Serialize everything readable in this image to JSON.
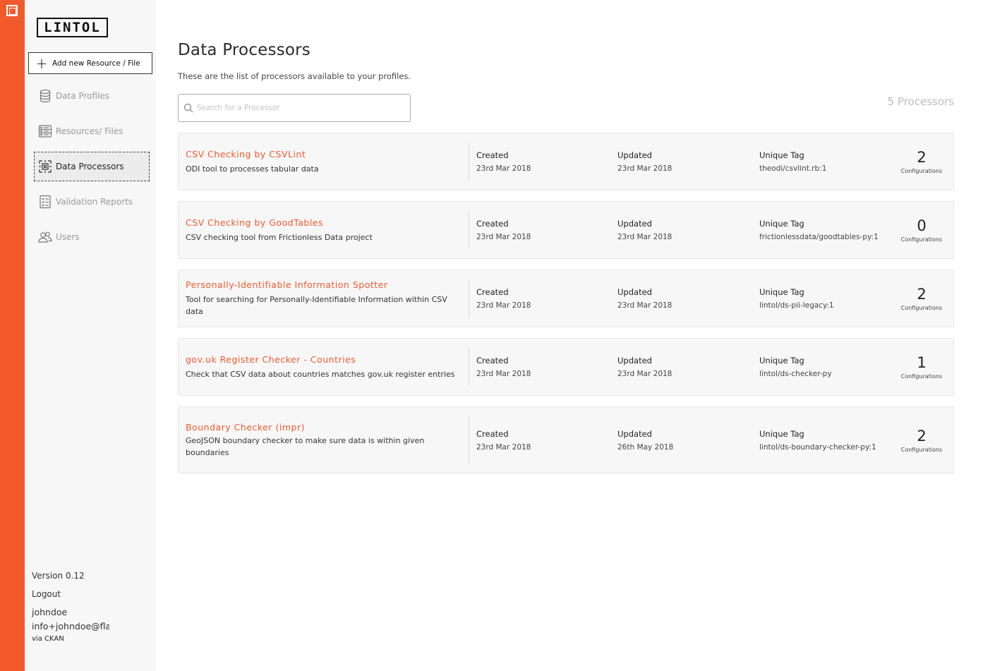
{
  "sidebar": {
    "logo": "LINTOL",
    "add_button": "Add new Resource / File",
    "items": [
      {
        "label": "Data Profiles",
        "icon": "database-icon"
      },
      {
        "label": "Resources/ Files",
        "icon": "files-icon"
      },
      {
        "label": "Data Processors",
        "icon": "processor-icon"
      },
      {
        "label": "Validation Reports",
        "icon": "checklist-icon"
      },
      {
        "label": "Users",
        "icon": "users-icon"
      }
    ],
    "active_item": "Data Processors",
    "version": "Version 0.12",
    "logout": "Logout",
    "username": "johndoe",
    "email": "info+johndoe@fla",
    "via": "via CKAN"
  },
  "page": {
    "title": "Data Processors",
    "subtitle": "These are the list of processors available to your profiles.",
    "search_placeholder": "Search for a Processor",
    "count_label": "5 Processors"
  },
  "labels": {
    "created": "Created",
    "updated": "Updated",
    "unique_tag": "Unique Tag",
    "configurations": "Configurations"
  },
  "processors": [
    {
      "name": "CSV Checking by CSVLint",
      "description": "ODI tool to processes tabular data",
      "created": "23rd Mar 2018",
      "updated": "23rd Mar 2018",
      "tag": "theodi/csvlint.rb:1",
      "configurations": "2"
    },
    {
      "name": "CSV Checking by GoodTables",
      "description": "CSV checking tool from Frictionless Data project",
      "created": "23rd Mar 2018",
      "updated": "23rd Mar 2018",
      "tag": "frictionlessdata/goodtables-py:1",
      "configurations": "0"
    },
    {
      "name": "Personally-Identifiable Information Spotter",
      "description": "Tool for searching for Personally-Identifiable Information within CSV data",
      "created": "23rd Mar 2018",
      "updated": "23rd Mar 2018",
      "tag": "lintol/ds-pii-legacy:1",
      "configurations": "2"
    },
    {
      "name": "gov.uk Register Checker - Countries",
      "description": "Check that CSV data about countries matches gov.uk register entries",
      "created": "23rd Mar 2018",
      "updated": "23rd Mar 2018",
      "tag": "lintol/ds-checker-py",
      "configurations": "1"
    },
    {
      "name": "Boundary Checker (impr)",
      "description": "GeoJSON boundary checker to make sure data is within given boundaries",
      "created": "23rd Mar 2018",
      "updated": "26th May 2018",
      "tag": "lintol/ds-boundary-checker-py:1",
      "configurations": "2"
    }
  ],
  "colors": {
    "accent": "#f25a2c",
    "sidebar_bg": "#f7f7f7",
    "card_bg": "#f7f7f7"
  }
}
